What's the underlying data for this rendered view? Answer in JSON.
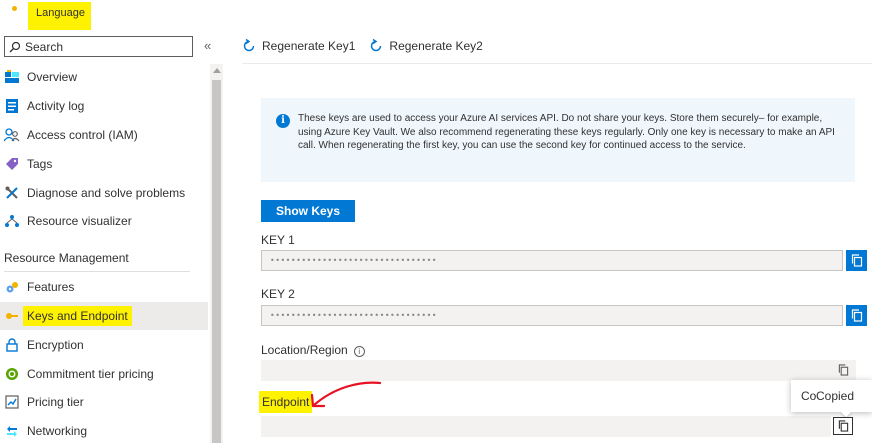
{
  "resource": {
    "title": "Language"
  },
  "search": {
    "placeholder": "Search"
  },
  "sidebar": {
    "items": [
      {
        "label": "Overview",
        "icon": "overview-icon"
      },
      {
        "label": "Activity log",
        "icon": "activity-log-icon"
      },
      {
        "label": "Access control (IAM)",
        "icon": "people-icon"
      },
      {
        "label": "Tags",
        "icon": "tag-icon"
      },
      {
        "label": "Diagnose and solve problems",
        "icon": "wrench-icon"
      },
      {
        "label": "Resource visualizer",
        "icon": "hierarchy-icon"
      }
    ],
    "section": "Resource Management",
    "section_items": [
      {
        "label": "Features",
        "icon": "features-icon"
      },
      {
        "label": "Keys and Endpoint",
        "icon": "key-icon",
        "active": true
      },
      {
        "label": "Encryption",
        "icon": "lock-icon"
      },
      {
        "label": "Commitment tier pricing",
        "icon": "commitment-icon"
      },
      {
        "label": "Pricing tier",
        "icon": "pricing-icon"
      },
      {
        "label": "Networking",
        "icon": "network-icon"
      }
    ]
  },
  "toolbar": {
    "regen_key1": "Regenerate Key1",
    "regen_key2": "Regenerate Key2"
  },
  "info": {
    "text": "These keys are used to access your Azure AI services API. Do not share your keys. Store them securely– for example, using Azure Key Vault. We also recommend regenerating these keys regularly. Only one key is necessary to make an API call. When regenerating the first key, you can use the second key for continued access to the service."
  },
  "show_keys": "Show Keys",
  "key1": {
    "label": "KEY 1",
    "value": "••••••••••••••••••••••••••••••••"
  },
  "key2": {
    "label": "KEY 2",
    "value": "••••••••••••••••••••••••••••••••"
  },
  "location": {
    "label": "Location/Region"
  },
  "endpoint": {
    "label": "Endpoint"
  },
  "tooltip": {
    "cut": "Co",
    "text": "Copied"
  },
  "colors": {
    "accent": "#0078d4",
    "highlight": "#fff200",
    "annotation": "#e81123"
  }
}
